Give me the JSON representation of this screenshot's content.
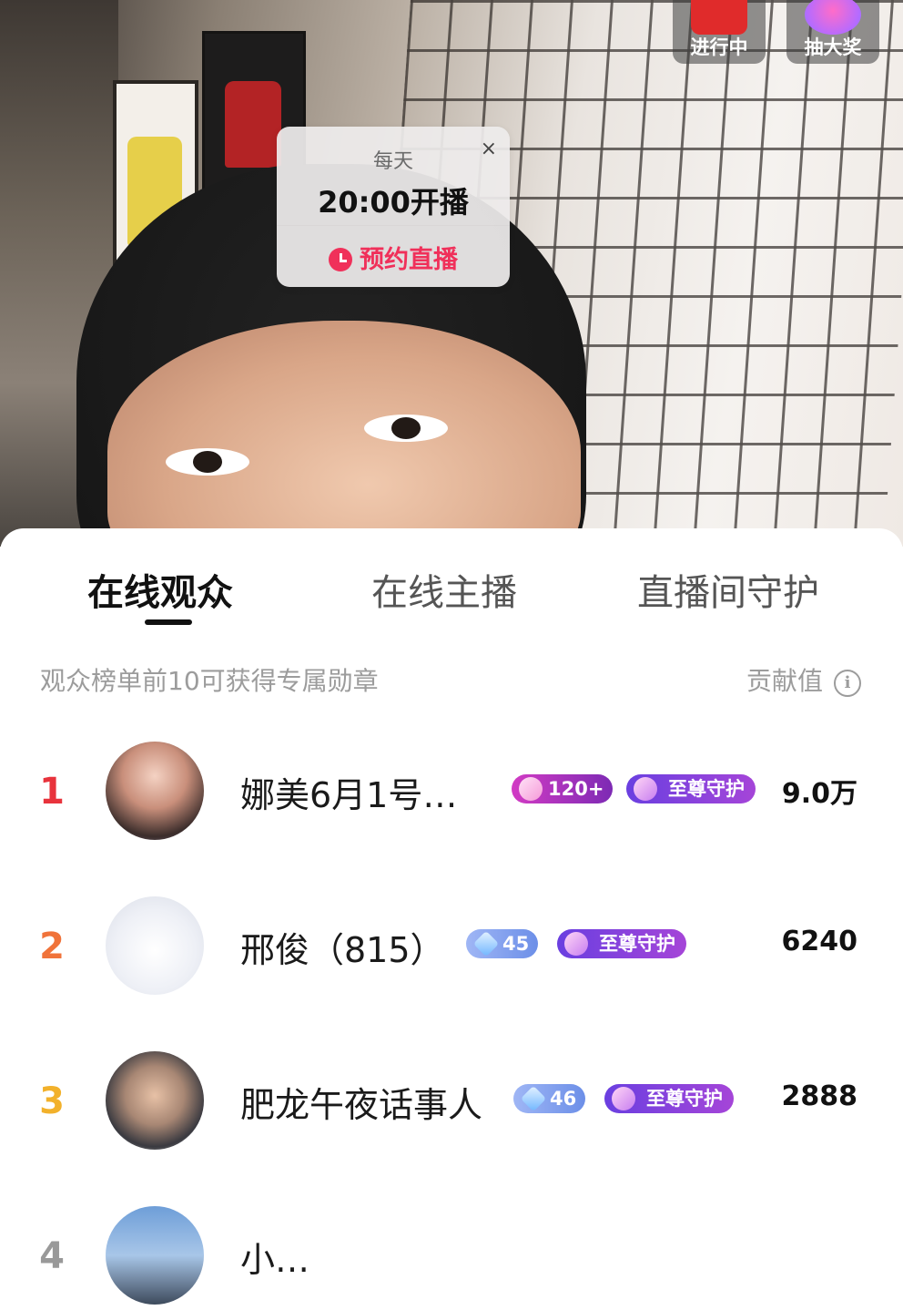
{
  "video": {
    "top_buttons": [
      {
        "label": "进行中"
      },
      {
        "label": "抽大奖"
      }
    ],
    "schedule_card": {
      "frequency": "每天",
      "time": "20:00开播",
      "action": "预约直播",
      "close": "×"
    }
  },
  "panel": {
    "tabs": [
      {
        "label": "在线观众",
        "active": true
      },
      {
        "label": "在线主播",
        "active": false
      },
      {
        "label": "直播间守护",
        "active": false
      }
    ],
    "hint": "观众榜单前10可获得专属勋章",
    "contribution_label": "贡献值",
    "info_icon": "i",
    "rank_colors": [
      "#e8333c",
      "#f0733a",
      "#f2b12b"
    ],
    "rows": [
      {
        "rank": "1",
        "name": "娜美6月1号…",
        "level": "120+",
        "guard": "至尊守护",
        "score": "9.0万"
      },
      {
        "rank": "2",
        "name": "邢俊（815）",
        "level": "45",
        "guard": "至尊守护",
        "score": "6240"
      },
      {
        "rank": "3",
        "name": "肥龙午夜话事人",
        "level": "46",
        "guard": "至尊守护",
        "score": "2888"
      },
      {
        "rank": "4",
        "name": "小…",
        "level": "",
        "guard": "",
        "score": ""
      }
    ]
  }
}
